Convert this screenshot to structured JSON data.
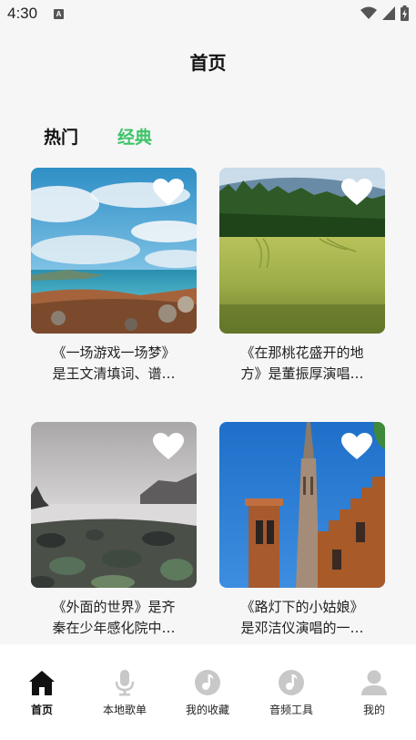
{
  "status_bar": {
    "time": "4:30",
    "notification_glyph": "A",
    "icons": [
      "wifi-icon",
      "signal-icon",
      "battery-icon"
    ]
  },
  "header": {
    "title": "首页"
  },
  "tabs": [
    {
      "label": "热门",
      "active": false
    },
    {
      "label": "经典",
      "active": true,
      "color": "#3fc46a"
    }
  ],
  "cards": [
    {
      "image": "sea-cliff-sky-photo",
      "line1": "《一场游戏一场梦》",
      "line2": "是王文清填词、谱…",
      "favorite_icon": "heart-icon"
    },
    {
      "image": "green-wheat-field-forest-photo",
      "line1": "《在那桃花盛开的地",
      "line2": "方》是董振厚演唱…",
      "favorite_icon": "heart-icon"
    },
    {
      "image": "misty-rocky-shore-photo",
      "line1": "《外面的世界》是齐",
      "line2": "秦在少年感化院中…",
      "favorite_icon": "heart-icon"
    },
    {
      "image": "brick-church-tower-photo",
      "line1": "《路灯下的小姑娘》",
      "line2": "是邓洁仪演唱的一…",
      "favorite_icon": "heart-icon"
    }
  ],
  "bottom_nav": [
    {
      "label": "首页",
      "icon": "home-icon",
      "active": true
    },
    {
      "label": "本地歌单",
      "icon": "microphone-icon",
      "active": false
    },
    {
      "label": "我的收藏",
      "icon": "music-disc-icon",
      "active": false
    },
    {
      "label": "音频工具",
      "icon": "music-disc-icon",
      "active": false
    },
    {
      "label": "我的",
      "icon": "person-icon",
      "active": false
    }
  ],
  "colors": {
    "accent": "#3fc46a",
    "background": "#f6f6f7",
    "nav_inactive": "#c8c8c8"
  }
}
